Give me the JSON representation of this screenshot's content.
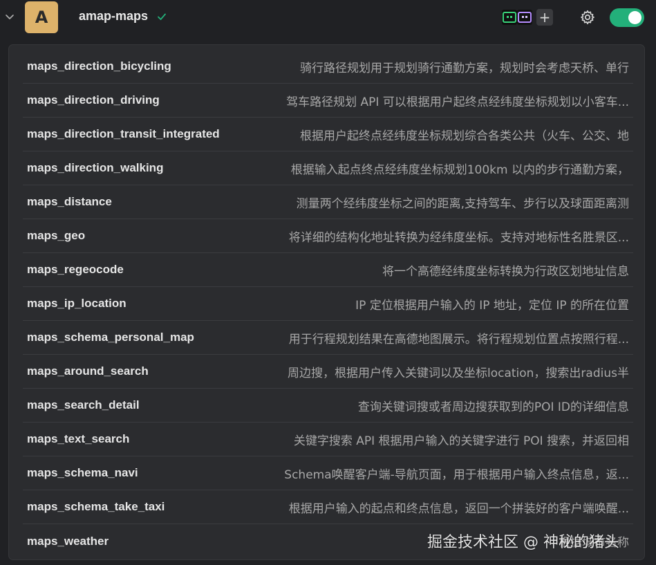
{
  "header": {
    "avatar_letter": "A",
    "server_name": "amap-maps",
    "add_label": "+",
    "toggle_state": "on",
    "accent_color": "#23b07a",
    "icons": [
      "chevron-down-icon",
      "verified-check-icon",
      "tool-icon",
      "tool-icon",
      "plus-icon",
      "gear-icon"
    ]
  },
  "tools": [
    {
      "name": "maps_direction_bicycling",
      "desc": "骑行路径规划用于规划骑行通勤方案，规划时会考虑天桥、单行"
    },
    {
      "name": "maps_direction_driving",
      "desc": "驾车路径规划 API 可以根据用户起终点经纬度坐标规划以小客车..."
    },
    {
      "name": "maps_direction_transit_integrated",
      "desc": "根据用户起终点经纬度坐标规划综合各类公共（火车、公交、地"
    },
    {
      "name": "maps_direction_walking",
      "desc": "根据输入起点终点经纬度坐标规划100km 以内的步行通勤方案，"
    },
    {
      "name": "maps_distance",
      "desc": "测量两个经纬度坐标之间的距离,支持驾车、步行以及球面距离测"
    },
    {
      "name": "maps_geo",
      "desc": "将详细的结构化地址转换为经纬度坐标。支持对地标性名胜景区..."
    },
    {
      "name": "maps_regeocode",
      "desc": "将一个高德经纬度坐标转换为行政区划地址信息"
    },
    {
      "name": "maps_ip_location",
      "desc": "IP 定位根据用户输入的 IP 地址，定位 IP 的所在位置"
    },
    {
      "name": "maps_schema_personal_map",
      "desc": "用于行程规划结果在高德地图展示。将行程规划位置点按照行程..."
    },
    {
      "name": "maps_around_search",
      "desc": "周边搜，根据用户传入关键词以及坐标location，搜索出radius半"
    },
    {
      "name": "maps_search_detail",
      "desc": "查询关键词搜或者周边搜获取到的POI ID的详细信息"
    },
    {
      "name": "maps_text_search",
      "desc": "关键字搜索 API 根据用户输入的关键字进行 POI 搜索，并返回相"
    },
    {
      "name": "maps_schema_navi",
      "desc": "Schema唤醒客户端-导航页面，用于根据用户输入终点信息，返..."
    },
    {
      "name": "maps_schema_take_taxi",
      "desc": "根据用户输入的起点和终点信息，返回一个拼装好的客户端唤醒..."
    },
    {
      "name": "maps_weather",
      "desc": "根据城市名称"
    }
  ],
  "watermark": "掘金技术社区 @ 神秘的猪头"
}
